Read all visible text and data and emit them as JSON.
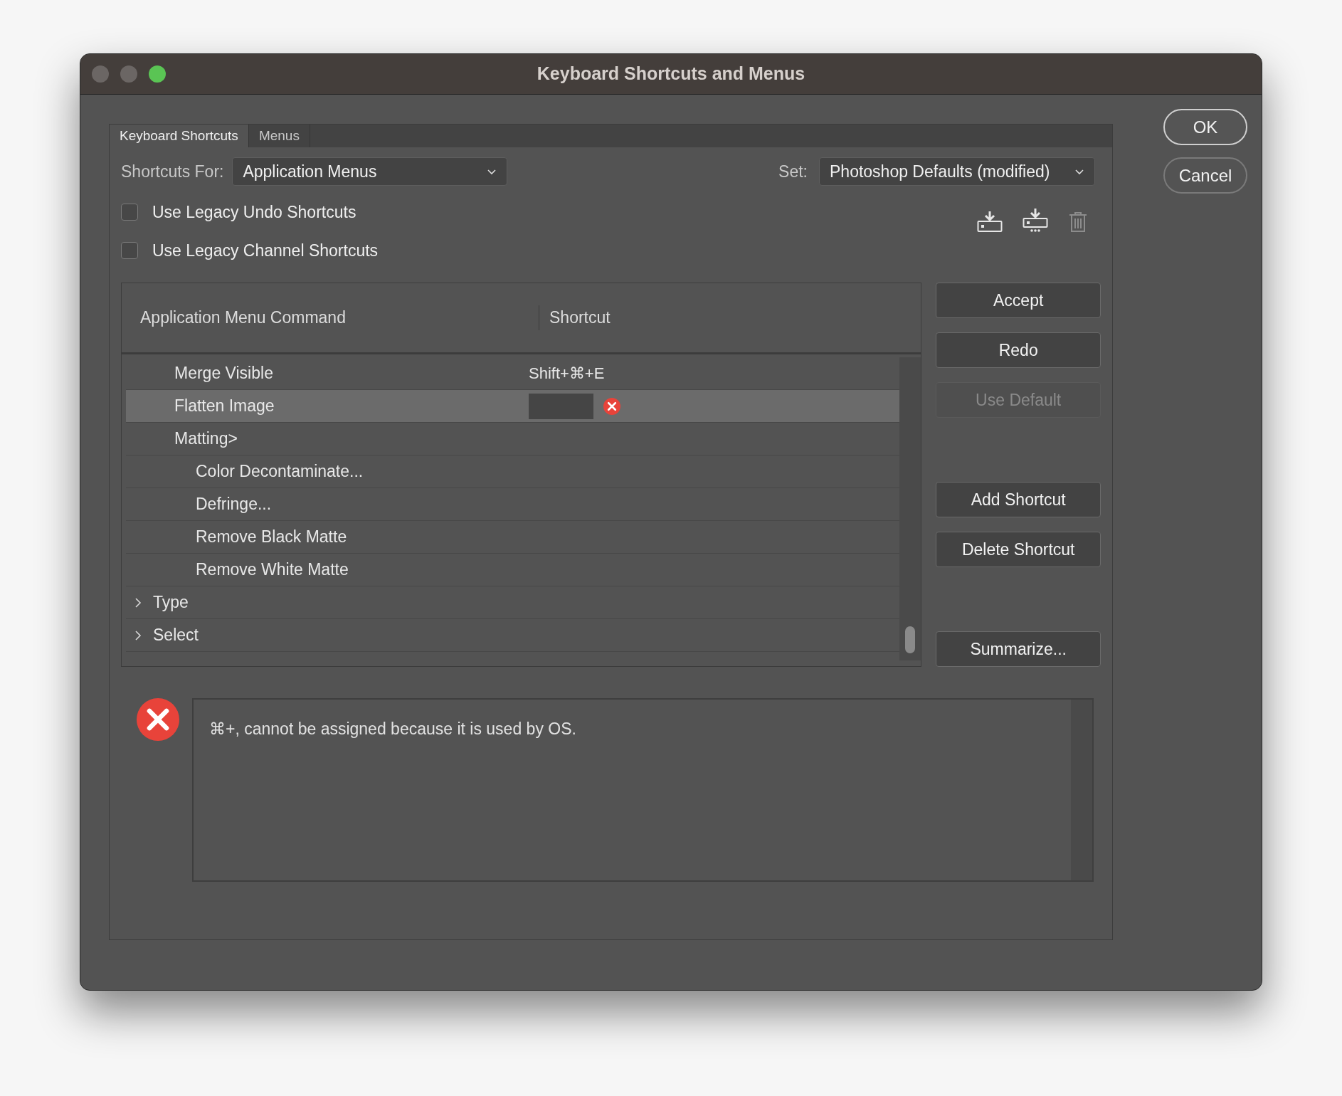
{
  "window": {
    "title": "Keyboard Shortcuts and Menus"
  },
  "tabs": [
    {
      "label": "Keyboard Shortcuts",
      "selected": true
    },
    {
      "label": "Menus",
      "selected": false
    }
  ],
  "shortcuts_for": {
    "label": "Shortcuts For:",
    "value": "Application Menus"
  },
  "set": {
    "label": "Set:",
    "value": "Photoshop Defaults (modified)"
  },
  "options": [
    {
      "label": "Use Legacy Undo Shortcuts",
      "checked": false
    },
    {
      "label": "Use Legacy Channel Shortcuts",
      "checked": false
    }
  ],
  "set_icons": [
    {
      "kind": "save",
      "disabled": false
    },
    {
      "kind": "save_as",
      "disabled": false
    },
    {
      "kind": "delete",
      "disabled": true
    }
  ],
  "table": {
    "columns": [
      "Application Menu Command",
      "Shortcut"
    ],
    "tree": [
      {
        "children": [
          {
            "label": "Merge Visible",
            "shortcut": "Shift+⌘+E",
            "selected": false
          },
          {
            "label": "Flatten Image",
            "selected": true,
            "editing": true,
            "error": true
          },
          {
            "label": "Matting>",
            "selected": false,
            "children": [
              {
                "label": "Color Decontaminate...",
                "selected": false
              },
              {
                "label": "Defringe...",
                "selected": false
              },
              {
                "label": "Remove Black Matte",
                "selected": false
              },
              {
                "label": "Remove White Matte",
                "selected": false
              }
            ]
          }
        ]
      },
      {
        "label": "Type",
        "expanded": false,
        "selected": false
      },
      {
        "label": "Select",
        "expanded": false,
        "selected": false
      }
    ]
  },
  "action_groups": [
    {
      "buttons": [
        {
          "label": "Accept",
          "disabled": false
        },
        {
          "label": "Redo",
          "disabled": false
        },
        {
          "label": "Use Default",
          "disabled": true
        }
      ]
    },
    {
      "buttons": [
        {
          "label": "Add Shortcut",
          "disabled": false
        },
        {
          "label": "Delete Shortcut",
          "disabled": false
        }
      ]
    },
    {
      "buttons": [
        {
          "label": "Summarize...",
          "disabled": false
        }
      ]
    }
  ],
  "message": {
    "kind": "error",
    "text": "⌘+, cannot be assigned because it is used by OS."
  },
  "dialog_buttons": [
    {
      "label": "OK",
      "default": true
    },
    {
      "label": "Cancel",
      "default": false
    }
  ]
}
